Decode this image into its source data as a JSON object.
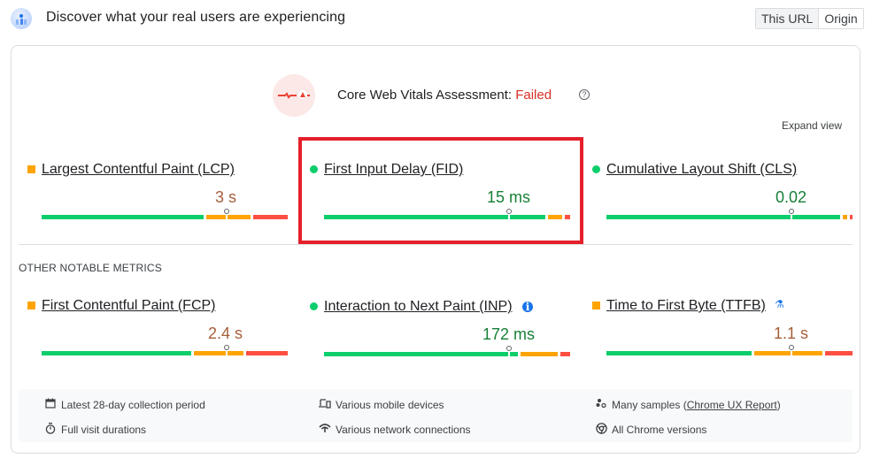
{
  "header": {
    "title": "Discover what your real users are experiencing",
    "logo_icon": "crux-users-icon",
    "toggle": {
      "options": [
        "This URL",
        "Origin"
      ],
      "selected": "This URL"
    }
  },
  "assessment": {
    "label": "Core Web Vitals Assessment:",
    "status": "Failed",
    "status_color": "#d93025",
    "icon": "heartbeat-failed-icon",
    "help_glyph": "?"
  },
  "expand_view": "Expand view",
  "core_metrics": [
    {
      "name": "Largest Contentful Paint (LCP)",
      "value": "3 s",
      "rating": "needs-improvement",
      "indicator": "square",
      "distribution": {
        "good": 67,
        "needs_improvement": 19,
        "poor": 14
      },
      "marker_percentile": 75
    },
    {
      "name": "First Input Delay (FID)",
      "value": "15 ms",
      "rating": "good",
      "indicator": "circle",
      "distribution": {
        "good": 91,
        "needs_improvement": 7,
        "poor": 2
      },
      "marker_percentile": 75,
      "highlighted": true
    },
    {
      "name": "Cumulative Layout Shift (CLS)",
      "value": "0.02",
      "rating": "good",
      "indicator": "circle",
      "distribution": {
        "good": 96,
        "needs_improvement": 3,
        "poor": 1
      },
      "marker_percentile": 75
    }
  ],
  "other_heading": "OTHER NOTABLE METRICS",
  "other_metrics": [
    {
      "name": "First Contentful Paint (FCP)",
      "value": "2.4 s",
      "rating": "needs-improvement",
      "indicator": "square",
      "distribution": {
        "good": 62,
        "needs_improvement": 21,
        "poor": 17
      },
      "marker_percentile": 75
    },
    {
      "name": "Interaction to Next Paint (INP)",
      "value": "172 ms",
      "rating": "good",
      "indicator": "circle",
      "extra_icon": "info-icon",
      "distribution": {
        "good": 80,
        "needs_improvement": 16,
        "poor": 4
      },
      "marker_percentile": 75
    },
    {
      "name": "Time to First Byte (TTFB)",
      "value": "1.1 s",
      "rating": "needs-improvement",
      "indicator": "square",
      "extra_icon": "experimental-flask-icon",
      "distribution": {
        "good": 60,
        "needs_improvement": 29,
        "poor": 11
      },
      "marker_percentile": 75
    }
  ],
  "footer": {
    "items": [
      {
        "icon": "calendar-icon",
        "text": "Latest 28-day collection period"
      },
      {
        "icon": "stopwatch-icon",
        "text": "Full visit durations"
      },
      {
        "icon": "devices-icon",
        "text": "Various mobile devices"
      },
      {
        "icon": "network-icon",
        "text": "Various network connections"
      },
      {
        "icon": "samples-icon",
        "text_before": "Many samples (",
        "link": "Chrome UX Report",
        "text_after": ")"
      },
      {
        "icon": "chrome-icon",
        "text": "All Chrome versions"
      }
    ]
  }
}
